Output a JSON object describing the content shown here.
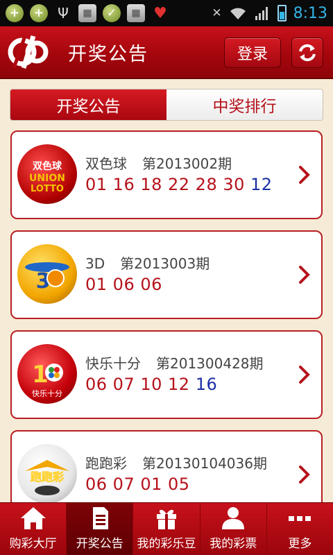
{
  "status_bar": {
    "time": "8:13"
  },
  "header": {
    "title": "开奖公告",
    "login_label": "登录"
  },
  "tabs": [
    {
      "label": "开奖公告",
      "active": true
    },
    {
      "label": "中奖排行",
      "active": false
    }
  ],
  "lotteries": [
    {
      "name": "双色球",
      "issue": "第2013002期",
      "red_numbers": "01 16 18 22 28 30",
      "blue_numbers": "12",
      "icon": "double-color-ball-logo"
    },
    {
      "name": "3D",
      "issue": "第2013003期",
      "red_numbers": "01 06 06",
      "blue_numbers": "",
      "icon": "3d-logo"
    },
    {
      "name": "快乐十分",
      "issue": "第201300428期",
      "red_numbers": "06 07 10 12",
      "blue_numbers": "16",
      "icon": "happy-ten-logo"
    },
    {
      "name": "跑跑彩",
      "issue": "第20130104036期",
      "red_numbers": "06 07 01 05",
      "blue_numbers": "",
      "icon": "running-lottery-logo"
    }
  ],
  "bottom_nav": [
    {
      "label": "购彩大厅",
      "icon": "home-icon",
      "active": false
    },
    {
      "label": "开奖公告",
      "icon": "document-icon",
      "active": true
    },
    {
      "label": "我的彩乐豆",
      "icon": "gift-icon",
      "active": false
    },
    {
      "label": "我的彩票",
      "icon": "user-icon",
      "active": false
    },
    {
      "label": "更多",
      "icon": "more-icon",
      "active": false
    }
  ],
  "logo_labels": {
    "ssq_line1": "双色球",
    "ssq_line2": "UNION",
    "ssq_line3": "LOTTO",
    "happy_ten": "快乐十分",
    "running": "跑跑彩"
  },
  "colors": {
    "brand_red": "#b5121b",
    "blue_ball": "#1c2fa8",
    "background": "#f6ebd6"
  }
}
